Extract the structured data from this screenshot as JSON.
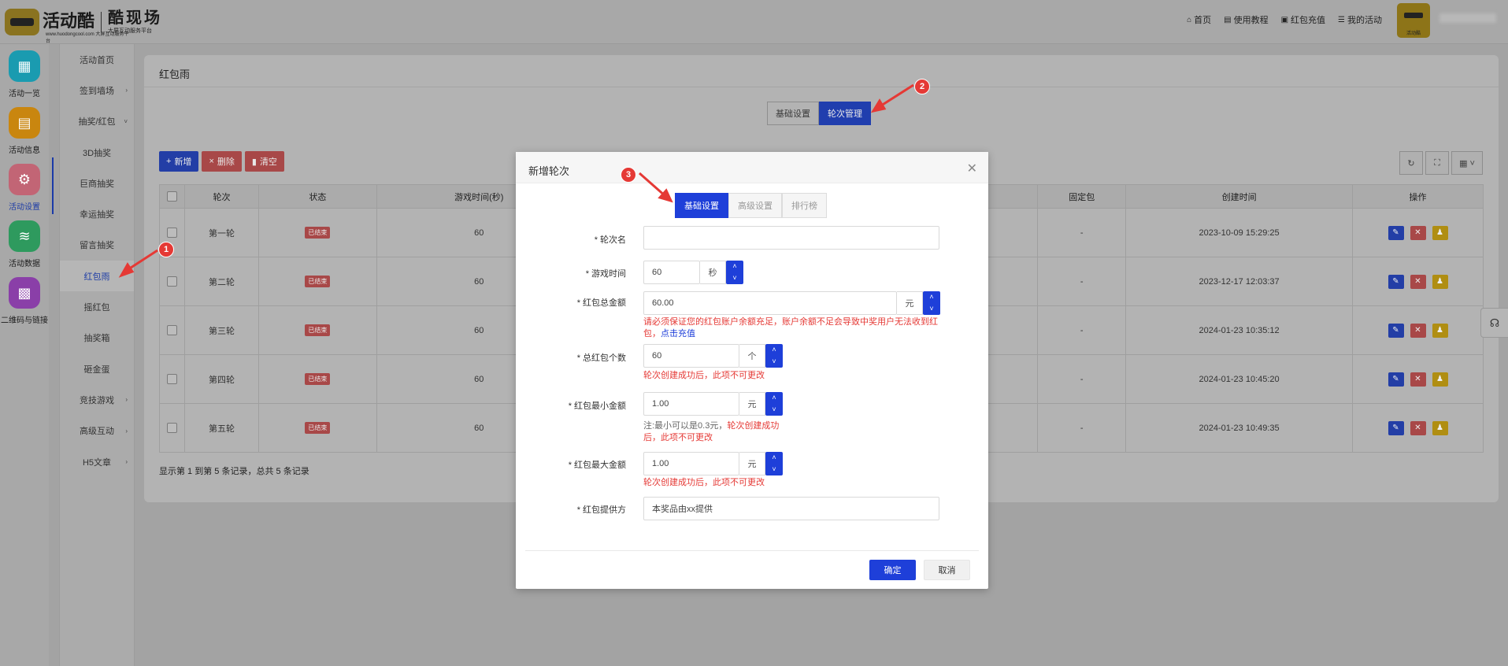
{
  "header": {
    "logo_text": "活动酷",
    "logo_sub": "www.huodongcool.com 大屏互动服务平台",
    "brand_title": "酷现场",
    "brand_sub": "大屏互动服务平台",
    "nav": [
      {
        "label": "首页",
        "icon": "home-icon"
      },
      {
        "label": "使用教程",
        "icon": "book-icon"
      },
      {
        "label": "红包充值",
        "icon": "wallet-icon"
      },
      {
        "label": "我的活动",
        "icon": "list-icon"
      }
    ],
    "avatar_text": "活动酷"
  },
  "iconbar": [
    {
      "label": "活动一览",
      "color": "#1a9bb0"
    },
    {
      "label": "活动信息",
      "color": "#c9860f"
    },
    {
      "label": "活动设置",
      "color": "#c26575"
    },
    {
      "label": "活动数据",
      "color": "#2e9a5e"
    },
    {
      "label": "二维码与链接",
      "color": "#8a3fa8"
    }
  ],
  "submenu": [
    {
      "label": "活动首页",
      "arrow": ""
    },
    {
      "label": "签到墙场",
      "arrow": "›"
    },
    {
      "label": "抽奖/红包",
      "arrow": "˅"
    },
    {
      "label": "3D抽奖",
      "arrow": ""
    },
    {
      "label": "巨商抽奖",
      "arrow": ""
    },
    {
      "label": "幸运抽奖",
      "arrow": ""
    },
    {
      "label": "留言抽奖",
      "arrow": ""
    },
    {
      "label": "红包雨",
      "arrow": ""
    },
    {
      "label": "摇红包",
      "arrow": ""
    },
    {
      "label": "抽奖箱",
      "arrow": ""
    },
    {
      "label": "砸金蛋",
      "arrow": ""
    },
    {
      "label": "竞技游戏",
      "arrow": "›"
    },
    {
      "label": "高级互动",
      "arrow": "›"
    },
    {
      "label": "H5文章",
      "arrow": "›"
    }
  ],
  "page": {
    "title": "红包雨",
    "tabs": [
      "基础设置",
      "轮次管理"
    ],
    "toolbar": {
      "add": "新增",
      "delete": "删除",
      "clear": "清空"
    },
    "footer": "显示第 1 到第 5 条记录，总共 5 条记录"
  },
  "table": {
    "headers": [
      "轮次",
      "状态",
      "游戏时间(秒)",
      "固定包",
      "创建时间",
      "操作"
    ],
    "rows": [
      {
        "round": "第一轮",
        "status": "已结束",
        "time": "60",
        "fixed": "-",
        "created": "2023-10-09 15:29:25"
      },
      {
        "round": "第二轮",
        "status": "已结束",
        "time": "60",
        "fixed": "-",
        "created": "2023-12-17 12:03:37"
      },
      {
        "round": "第三轮",
        "status": "已结束",
        "time": "60",
        "fixed": "-",
        "created": "2024-01-23 10:35:12"
      },
      {
        "round": "第四轮",
        "status": "已结束",
        "time": "60",
        "fixed": "-",
        "created": "2024-01-23 10:45:20"
      },
      {
        "round": "第五轮",
        "status": "已结束",
        "time": "60",
        "fixed": "-",
        "created": "2024-01-23 10:49:35"
      }
    ]
  },
  "modal": {
    "title": "新增轮次",
    "tabs": [
      "基础设置",
      "高级设置",
      "排行榜"
    ],
    "fields": {
      "round_name": {
        "label": "轮次名",
        "value": ""
      },
      "game_time": {
        "label": "游戏时间",
        "value": "60",
        "unit": "秒"
      },
      "total_amount": {
        "label": "红包总金额",
        "value": "60.00",
        "unit": "元"
      },
      "total_amount_note": "请必须保证您的红包账户余额充足，账户余额不足会导致中奖用户无法收到红包，",
      "total_amount_link": "点击充值",
      "total_count": {
        "label": "总红包个数",
        "value": "60",
        "unit": "个"
      },
      "total_count_note": "轮次创建成功后，此项不可更改",
      "min_amount": {
        "label": "红包最小金额",
        "value": "1.00",
        "unit": "元"
      },
      "min_amount_note_gray": "注:最小可以是0.3元，",
      "min_amount_note_red": "轮次创建成功后，此项不可更改",
      "max_amount": {
        "label": "红包最大金额",
        "value": "1.00",
        "unit": "元"
      },
      "max_amount_note": "轮次创建成功后，此项不可更改",
      "provider": {
        "label": "红包提供方",
        "value": "本奖品由xx提供"
      }
    },
    "ok": "确定",
    "cancel": "取消"
  },
  "markers": [
    "1",
    "2",
    "3"
  ],
  "colors": {
    "primary": "#1e3fd9",
    "danger": "#e53935",
    "warning": "#e0b020"
  }
}
